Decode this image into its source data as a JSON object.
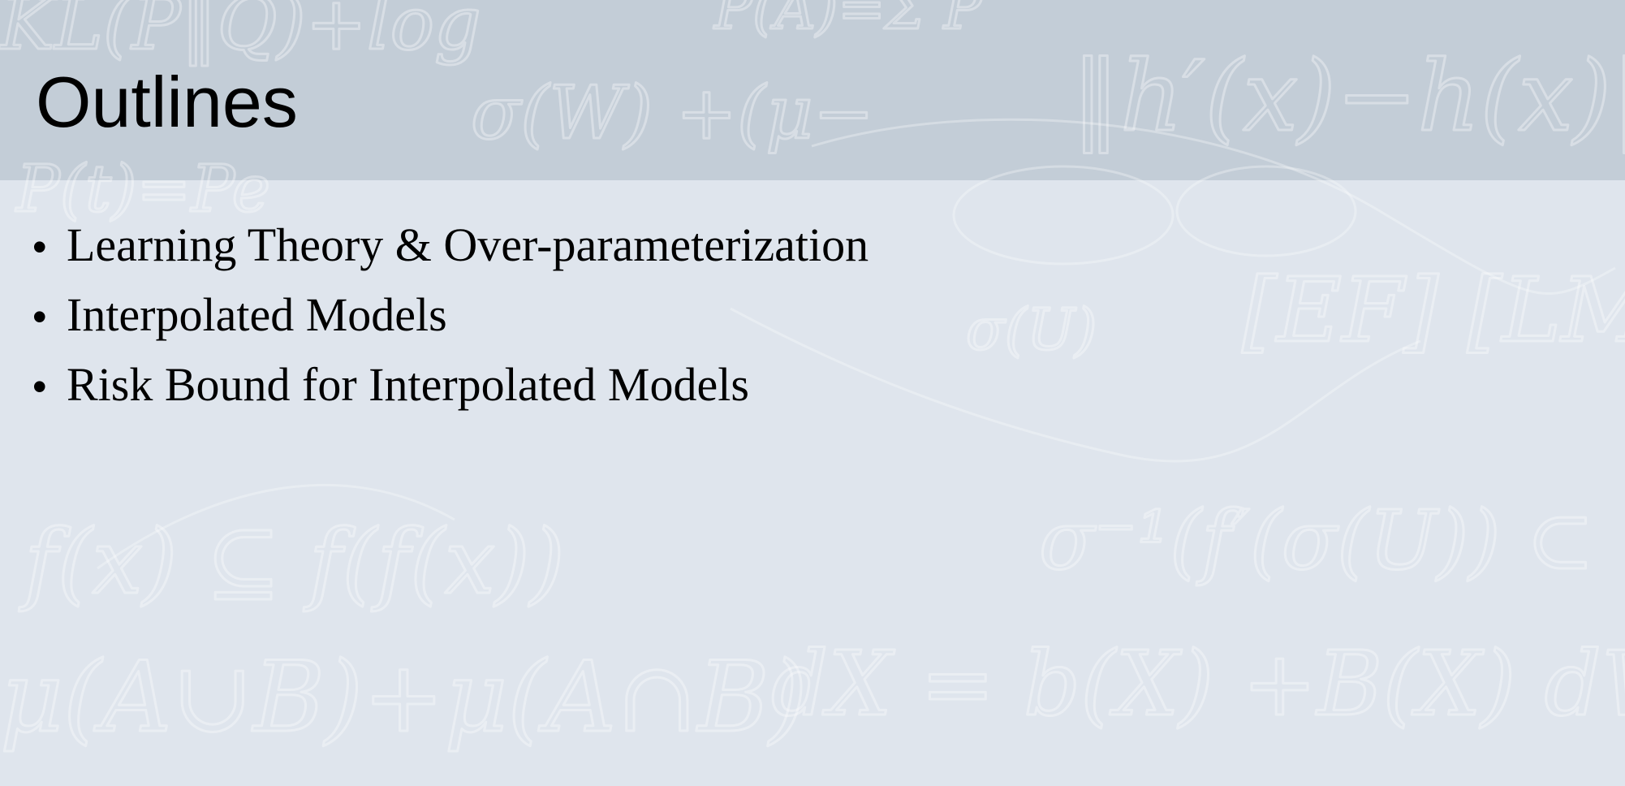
{
  "slide": {
    "title": "Outlines",
    "bullet_glyph": "•",
    "bullets": [
      {
        "text": "Learning Theory & Over-parameterization"
      },
      {
        "text": "Interpolated Models"
      },
      {
        "text": "Risk Bound for Interpolated Models"
      }
    ]
  },
  "colors": {
    "title_band": "#c3cdd7",
    "background": "#dfe5ed",
    "text": "#000000"
  }
}
